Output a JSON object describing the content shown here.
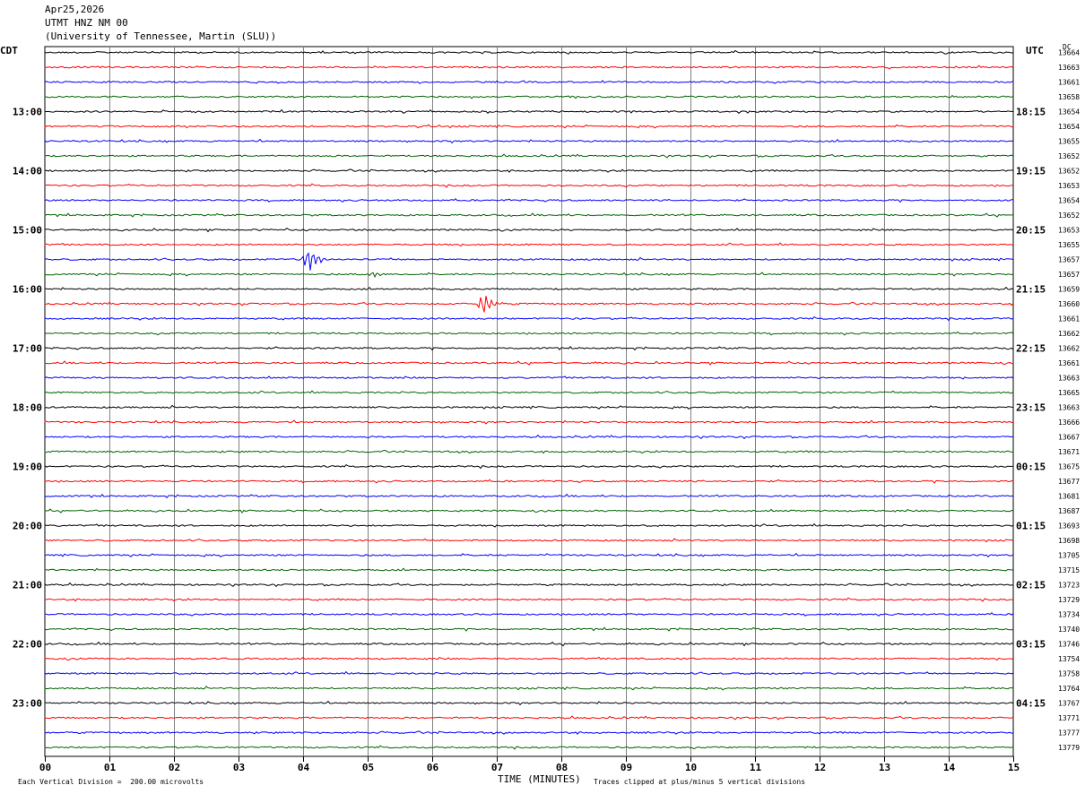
{
  "header": {
    "date": "Apr25,2026",
    "station": "UTMT HNZ NM 00",
    "network": "(University of Tennessee, Martin (SLU))"
  },
  "left_tz": "CDT",
  "right_tz": "UTC",
  "dc_label": "DC",
  "footer": {
    "scale": "Each Vertical Division =  200.00 microvolts",
    "clip": "Traces clipped at plus/minus 5 vertical divisions"
  },
  "colors": {
    "black": "#000000",
    "red": "#ff0000",
    "blue": "#0000ff",
    "green": "#006400",
    "grid": "#808080"
  },
  "chart_data": {
    "type": "line",
    "xlabel": "TIME (MINUTES)",
    "xlim": [
      0,
      15
    ],
    "x_ticks": [
      "00",
      "01",
      "02",
      "03",
      "04",
      "05",
      "06",
      "07",
      "08",
      "09",
      "10",
      "11",
      "12",
      "13",
      "14",
      "15"
    ],
    "trace_colors": [
      "black",
      "red",
      "blue",
      "green"
    ],
    "left_time_labels": [
      "13:00",
      "14:00",
      "15:00",
      "16:00",
      "17:00",
      "18:00",
      "19:00",
      "20:00",
      "21:00",
      "22:00",
      "23:00"
    ],
    "right_time_labels": [
      "18:15",
      "19:15",
      "20:15",
      "21:15",
      "22:15",
      "23:15",
      "00:15",
      "01:15",
      "02:15",
      "03:15",
      "04:15"
    ],
    "dc_values": [
      13664,
      13663,
      13661,
      13658,
      13654,
      13654,
      13655,
      13652,
      13652,
      13653,
      13654,
      13652,
      13653,
      13655,
      13657,
      13657,
      13659,
      13660,
      13661,
      13662,
      13662,
      13661,
      13663,
      13665,
      13663,
      13666,
      13667,
      13671,
      13675,
      13677,
      13681,
      13687,
      13693,
      13698,
      13705,
      13715,
      13723,
      13729,
      13734,
      13740,
      13746,
      13754,
      13758,
      13764,
      13767,
      13771,
      13777,
      13779
    ],
    "events": [
      {
        "trace": 14,
        "minute": 4.1,
        "amplitude": 1.6
      },
      {
        "trace": 15,
        "minute": 5.1,
        "amplitude": 0.4
      },
      {
        "trace": 17,
        "minute": 6.8,
        "amplitude": 1.5
      }
    ]
  }
}
